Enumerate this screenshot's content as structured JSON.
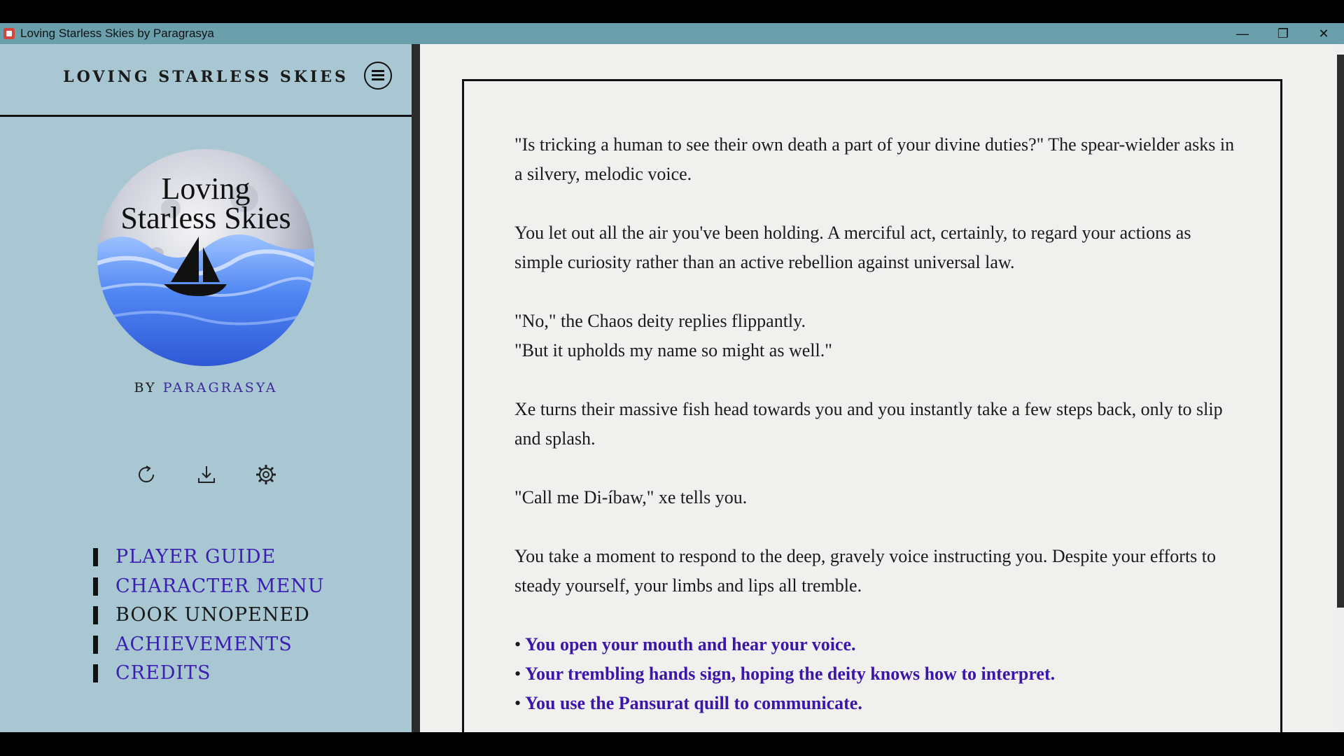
{
  "window": {
    "title": "Loving Starless Skies by Paragrasya",
    "minimize_glyph": "—",
    "restore_glyph": "❐",
    "close_glyph": "✕"
  },
  "sidebar": {
    "title": "LOVING STARLESS SKIES",
    "cover_title_line1": "Loving",
    "cover_title_line2": "Starless Skies",
    "by_label": "BY",
    "author": "PARAGRASYA",
    "menu": [
      {
        "label": "PLAYER GUIDE",
        "enabled": true
      },
      {
        "label": "CHARACTER MENU",
        "enabled": true
      },
      {
        "label": "BOOK UNOPENED",
        "enabled": false
      },
      {
        "label": "ACHIEVEMENTS",
        "enabled": true
      },
      {
        "label": "CREDITS",
        "enabled": true
      }
    ],
    "tools": [
      "restart-icon",
      "download-icon",
      "gear-icon"
    ]
  },
  "story": {
    "paragraphs": [
      "\"Is tricking a human to see their own death a part of your divine duties?\" The spear-wielder asks in a silvery, melodic voice.",
      "You let out all the air you've been holding. A merciful act, certainly, to regard your actions as simple curiosity rather than an active rebellion against universal law.",
      "\"No,\" the Chaos deity replies flippantly.",
      "\"But it upholds my name so might as well.\"",
      "Xe turns their massive fish head towards you and you instantly take a few steps back, only to slip and splash.",
      "\"Call me Di-íbaw,\" xe tells you.",
      "You take a moment to respond to the deep, gravely voice instructing you. Despite your efforts to steady yourself, your limbs and lips all tremble."
    ],
    "choices": [
      "You open your mouth and hear your voice.",
      "Your trembling hands sign, hoping the deity knows how to interpret.",
      "You use the Pansurat quill to communicate."
    ]
  },
  "colors": {
    "sidebar_bg": "#a8c7d3",
    "titlebar_bg": "#6a9fac",
    "link": "#3b1fb0",
    "choice": "#3b16a8",
    "page_bg": "#f0f0ef"
  }
}
